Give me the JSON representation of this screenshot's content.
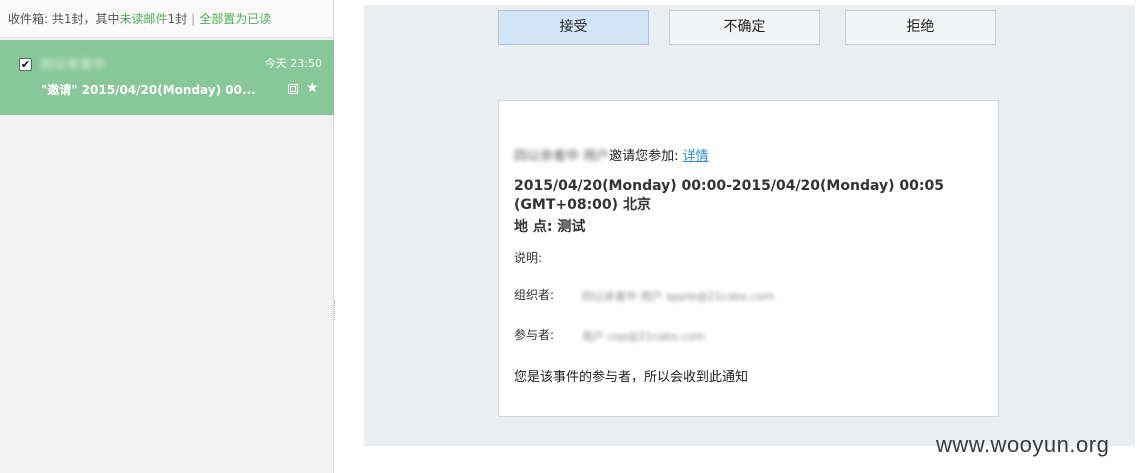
{
  "inbox": {
    "label": "收件箱: 共1封，其中",
    "unread_label": "未读邮件",
    "unread_count": "1封",
    "separator": "|",
    "mark_all_read": "全部置为已读"
  },
  "mail_item": {
    "checked": "✔",
    "sender": "四以余者中 ",
    "time": "今天 23:50",
    "subject": "\"邀请\" 2015/04/20(Monday) 00...",
    "star": "★"
  },
  "actions": {
    "accept": "接受",
    "maybe": "不确定",
    "decline": "拒绝"
  },
  "invite": {
    "org_blurred": "四以余者中 用户",
    "invite_text": "邀请您参加:",
    "detail_link": "详情",
    "time_range": "2015/04/20(Monday) 00:00-2015/04/20(Monday) 00:05 (GMT+08:00) 北京",
    "location": "地 点: 测试",
    "description_label": "说明:",
    "organizer_label": "组织者:",
    "organizer_value": "四以余者中 用户 apple@21cake.com",
    "attendees_label": "参与者:",
    "attendees_value": "用户 cop@21cake.com",
    "footer": "您是该事件的参与者，所以会收到此通知"
  },
  "watermark": "www.wooyun.org"
}
